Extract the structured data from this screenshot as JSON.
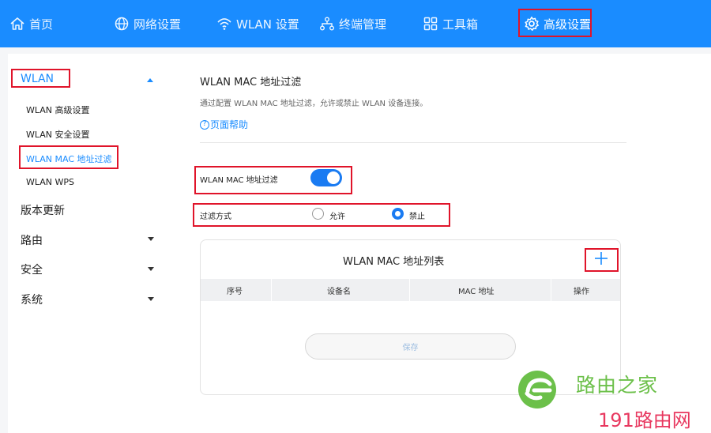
{
  "nav": {
    "items": [
      {
        "label": "首页",
        "icon": "home-icon"
      },
      {
        "label": "网络设置",
        "icon": "globe-icon"
      },
      {
        "label": "WLAN 设置",
        "icon": "wifi-icon"
      },
      {
        "label": "终端管理",
        "icon": "devices-icon"
      },
      {
        "label": "工具箱",
        "icon": "toolbox-icon"
      },
      {
        "label": "高级设置",
        "icon": "gear-icon"
      }
    ],
    "active": "高级设置",
    "bg_color": "#1a8cff"
  },
  "sidebar": {
    "wlan_group": "WLAN",
    "wlan_items": [
      "WLAN 高级设置",
      "WLAN 安全设置",
      "WLAN MAC 地址过滤",
      "WLAN WPS"
    ],
    "active_item": "WLAN MAC 地址过滤",
    "groups": [
      "版本更新",
      "路由",
      "安全",
      "系统"
    ]
  },
  "page": {
    "title": "WLAN MAC 地址过滤",
    "description": "通过配置 WLAN MAC 地址过滤，允许或禁止 WLAN 设备连接。",
    "help": "页面帮助"
  },
  "filter": {
    "toggle_label": "WLAN MAC 地址过滤",
    "toggle_on": true,
    "mode_label": "过滤方式",
    "allow_label": "允许",
    "deny_label": "禁止",
    "selected": "禁止"
  },
  "table": {
    "title": "WLAN MAC 地址列表",
    "columns": [
      "序号",
      "设备名",
      "MAC 地址",
      "操作"
    ],
    "rows": []
  },
  "save_label": "保存",
  "watermark": {
    "line1": "路由之家",
    "line2": "191路由网"
  },
  "colors": {
    "accent": "#1a8cff",
    "highlight_box": "#e0142a"
  }
}
